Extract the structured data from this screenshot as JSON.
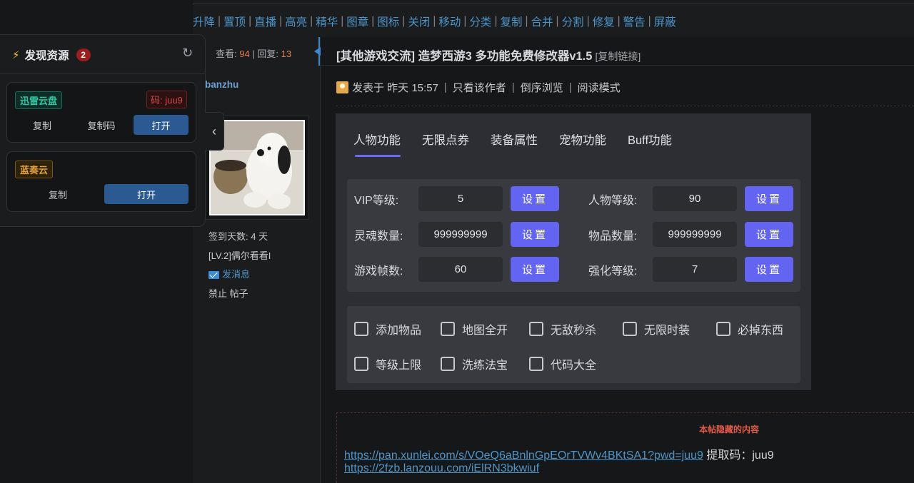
{
  "toolbar": {
    "links": [
      "升降",
      "置顶",
      "直播",
      "高亮",
      "精华",
      "图章",
      "图标",
      "关闭",
      "移动",
      "分类",
      "复制",
      "合并",
      "分割",
      "修复",
      "警告",
      "屏蔽"
    ]
  },
  "thread_stats": {
    "views_label": "查看:",
    "views": "94",
    "separator": "|",
    "replies_label": "回复:",
    "replies": "13"
  },
  "author": {
    "name": "banzhu",
    "checkin": "签到天数: 4 天",
    "level": "[LV.2]偶尔看看I",
    "message": "发消息",
    "ban": "禁止 帖子"
  },
  "post": {
    "title": "[其他游戏交流] 造梦西游3 多功能免费修改器v1.5",
    "copy_link": "[复制链接]",
    "posted_at": "发表于 昨天 15:57",
    "only_author": "只看该作者",
    "reverse": "倒序浏览",
    "read_mode": "阅读模式"
  },
  "trainer": {
    "tabs": [
      "人物功能",
      "无限点券",
      "装备属性",
      "宠物功能",
      "Buff功能"
    ],
    "active_tab": "人物功能",
    "set_label": "设置",
    "fields": [
      {
        "label": "VIP等级:",
        "value": "5"
      },
      {
        "label": "人物等级:",
        "value": "90"
      },
      {
        "label": "灵魂数量:",
        "value": "999999999"
      },
      {
        "label": "物品数量:",
        "value": "999999999"
      },
      {
        "label": "游戏帧数:",
        "value": "60"
      },
      {
        "label": "强化等级:",
        "value": "7"
      }
    ],
    "checkboxes": [
      "添加物品",
      "地图全开",
      "无敌秒杀",
      "无限时装",
      "必掉东西",
      "等级上限",
      "洗练法宝",
      "代码大全"
    ]
  },
  "hidden": {
    "title": "本帖隐藏的内容",
    "link1": "https://pan.xunlei.com/s/VOeQ6aBnlnGpEOrTVWv4BKtSA1?pwd=juu9",
    "code_text": "提取码：juu9",
    "link2": "https://2fzb.lanzouu.com/iElRN3bkwiuf"
  },
  "resources": {
    "title": "发现资源",
    "count": "2",
    "cards": [
      {
        "tag": "迅雷云盘",
        "code": "码: juu9",
        "copy": "复制",
        "copy_code": "复制码",
        "open": "打开"
      },
      {
        "tag": "蓝奏云",
        "copy": "复制",
        "open": "打开"
      }
    ]
  },
  "colors": {
    "accent_blue": "#4d95c9",
    "trainer_button": "#6464f2",
    "badge_red": "#9d1d1d"
  }
}
